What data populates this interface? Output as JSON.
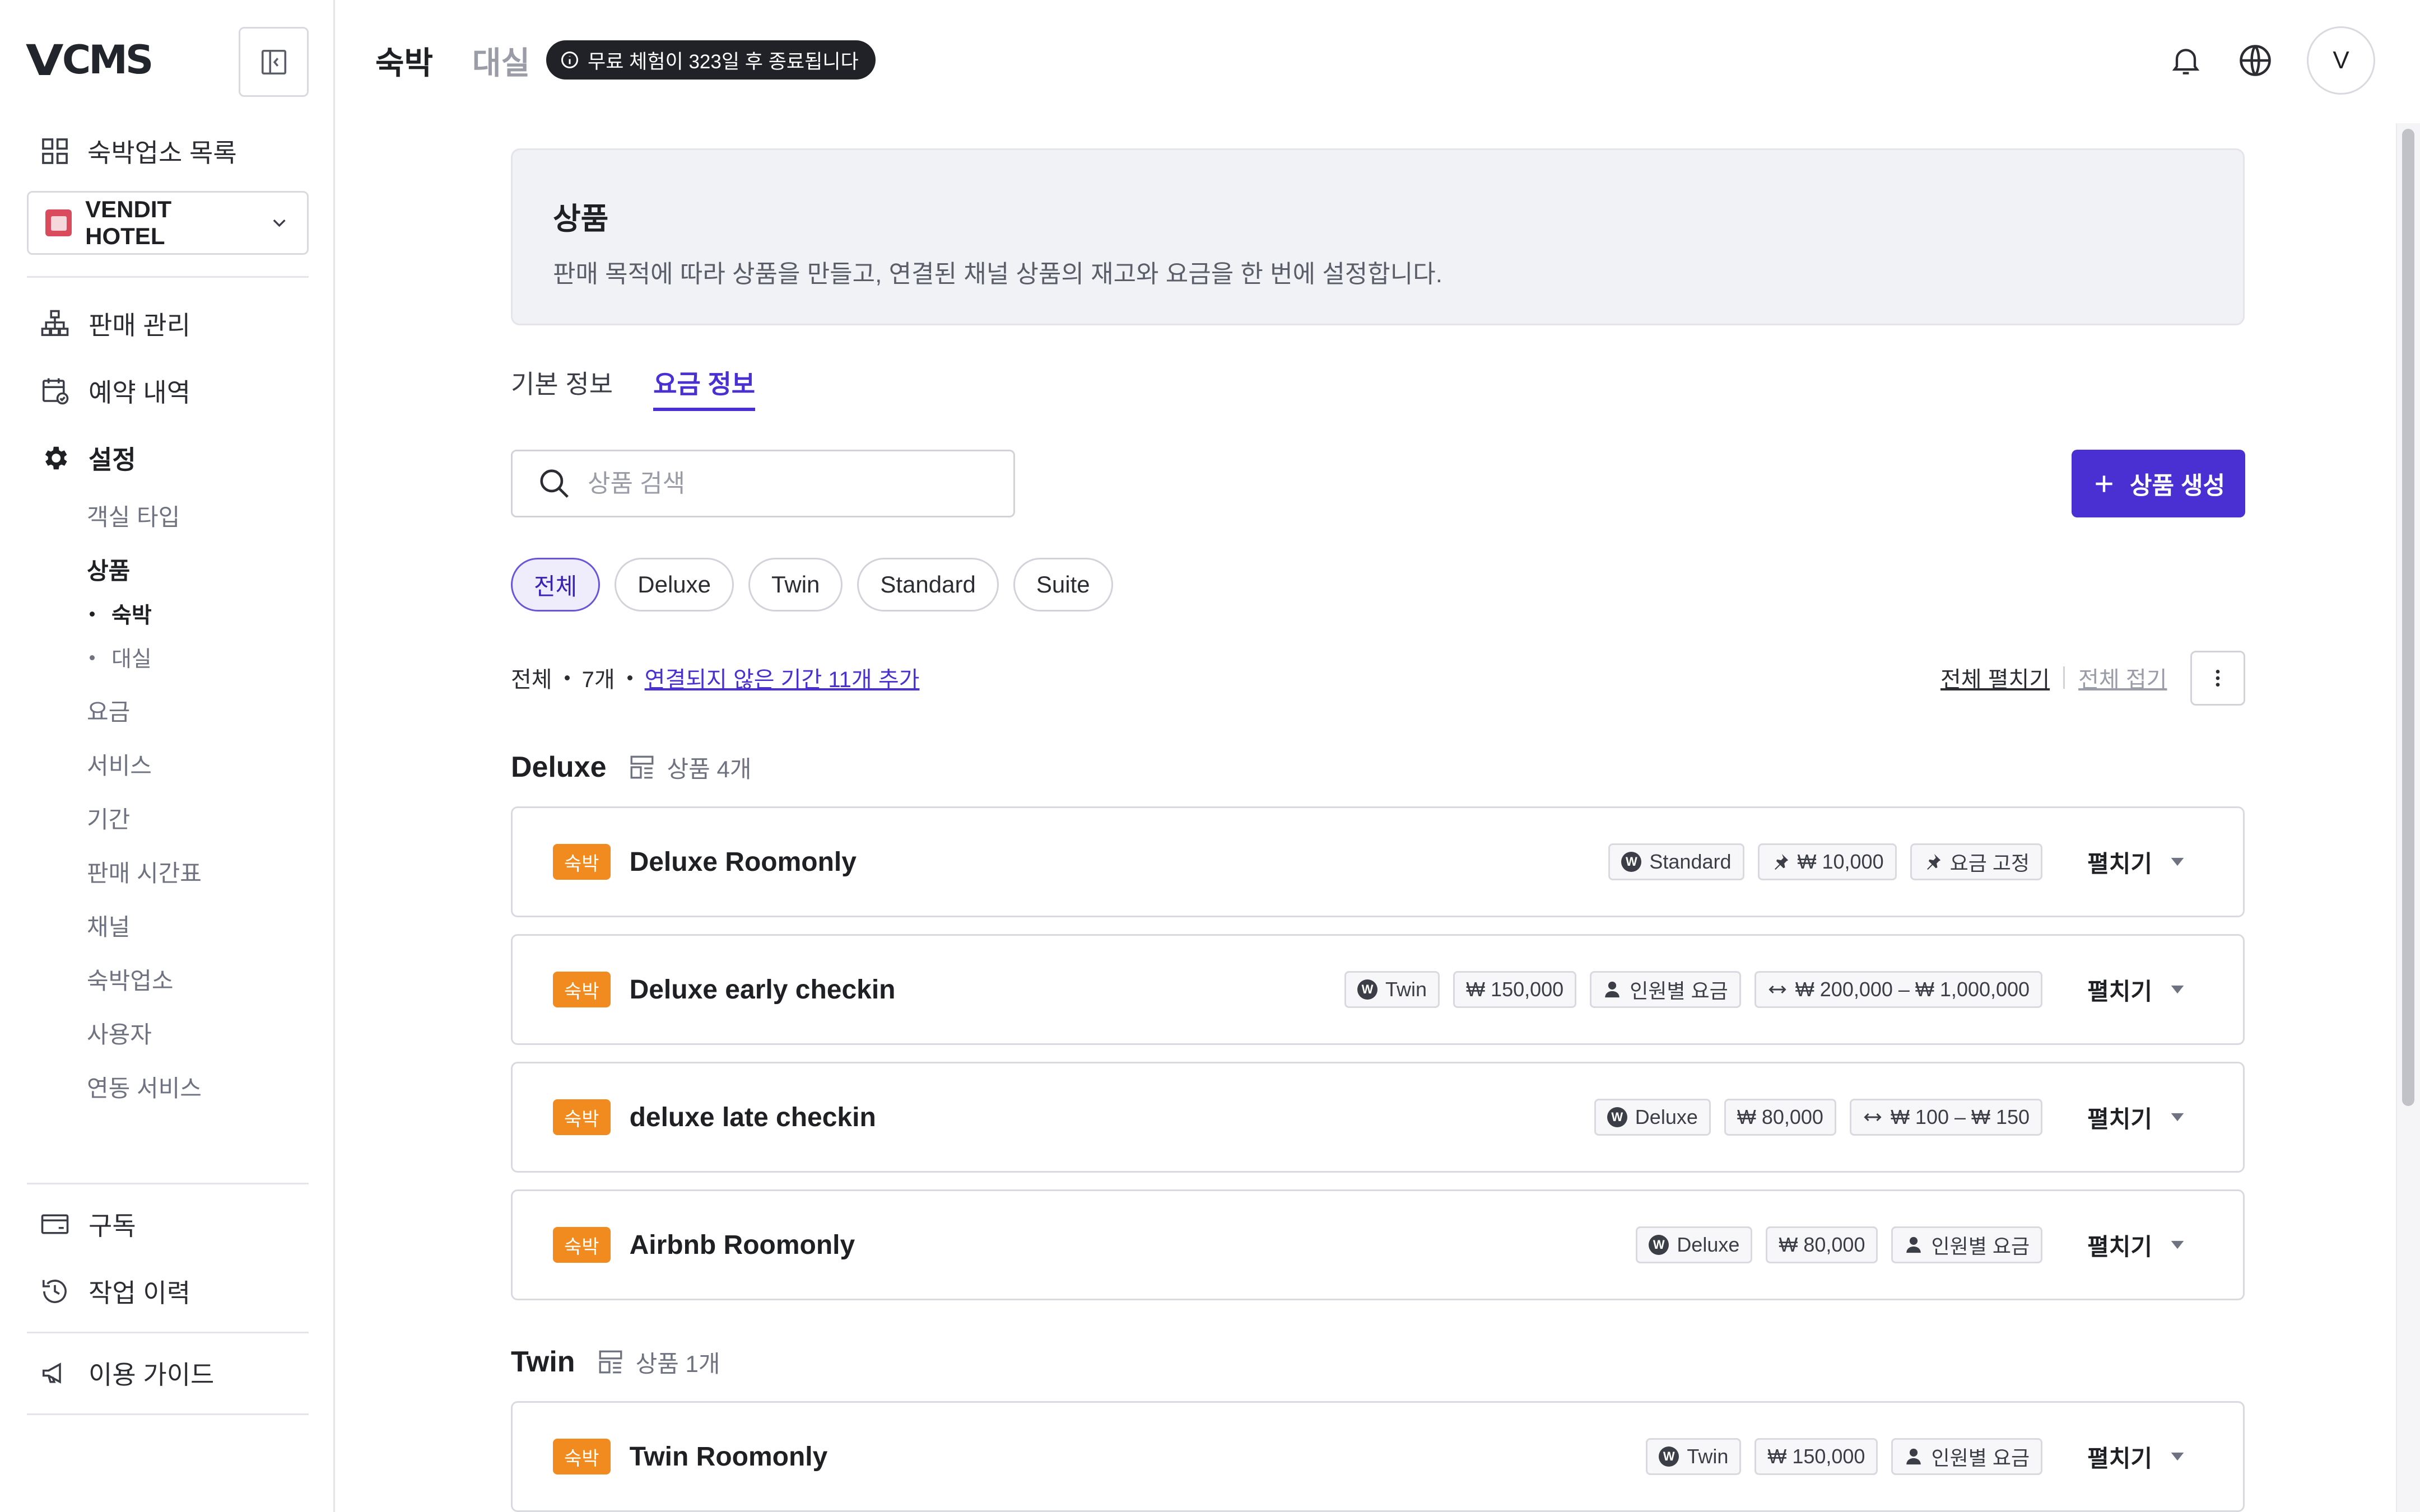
{
  "app": {
    "logo": "CMS"
  },
  "sidebar": {
    "top_link": "숙박업소 목록",
    "hotel": "VENDIT HOTEL",
    "nav": [
      {
        "label": "판매 관리",
        "icon": "sitemap-icon"
      },
      {
        "label": "예약 내역",
        "icon": "calendar-check-icon"
      },
      {
        "label": "설정",
        "icon": "gear-icon"
      }
    ],
    "settings_items": [
      "객실 타입",
      "상품",
      "요금",
      "서비스",
      "기간",
      "판매 시간표",
      "채널",
      "숙박업소",
      "사용자",
      "연동 서비스"
    ],
    "product_sub": [
      "숙박",
      "대실"
    ],
    "bottom": [
      {
        "label": "구독",
        "icon": "card-icon"
      },
      {
        "label": "작업 이력",
        "icon": "history-icon"
      },
      {
        "label": "이용 가이드",
        "icon": "megaphone-icon"
      }
    ]
  },
  "header": {
    "tab_active": "숙박",
    "tab_inactive": "대실",
    "trial": "무료 체험이 323일 후 종료됩니다",
    "avatar": "V"
  },
  "intro": {
    "title": "상품",
    "desc": "판매 목적에 따라 상품을 만들고, 연결된 채널 상품의 재고와 요금을 한 번에 설정합니다."
  },
  "tabs": [
    "기본 정보",
    "요금 정보"
  ],
  "search": {
    "placeholder": "상품 검색",
    "value": ""
  },
  "create_button": "상품 생성",
  "filters": [
    "전체",
    "Deluxe",
    "Twin",
    "Standard",
    "Suite"
  ],
  "summary": {
    "all": "전체",
    "count": "7개",
    "link": "연결되지 않은 기간 11개 추가",
    "expand_all": "전체 펼치기",
    "collapse_all": "전체 접기"
  },
  "groups": [
    {
      "name": "Deluxe",
      "count": "상품 4개"
    },
    {
      "name": "Twin",
      "count": "상품 1개"
    }
  ],
  "expand_label": "펼치기",
  "products": [
    {
      "badge": "숙박",
      "name": "Deluxe Roomonly",
      "tags": [
        {
          "icon": "w",
          "text": "Standard"
        },
        {
          "icon": "pin",
          "text": "₩ 10,000"
        },
        {
          "icon": "pin",
          "text": "요금 고정"
        }
      ]
    },
    {
      "badge": "숙박",
      "name": "Deluxe early checkin",
      "tags": [
        {
          "icon": "w",
          "text": "Twin"
        },
        {
          "icon": "",
          "text": "₩ 150,000"
        },
        {
          "icon": "person",
          "text": "인원별 요금"
        },
        {
          "icon": "range",
          "text": "₩ 200,000 – ₩ 1,000,000"
        }
      ]
    },
    {
      "badge": "숙박",
      "name": "deluxe late checkin",
      "tags": [
        {
          "icon": "w",
          "text": "Deluxe"
        },
        {
          "icon": "",
          "text": "₩ 80,000"
        },
        {
          "icon": "range",
          "text": "₩ 100 – ₩ 150"
        }
      ]
    },
    {
      "badge": "숙박",
      "name": "Airbnb Roomonly",
      "tags": [
        {
          "icon": "w",
          "text": "Deluxe"
        },
        {
          "icon": "",
          "text": "₩ 80,000"
        },
        {
          "icon": "person",
          "text": "인원별 요금"
        }
      ]
    },
    {
      "badge": "숙박",
      "name": "Twin Roomonly",
      "tags": [
        {
          "icon": "w",
          "text": "Twin"
        },
        {
          "icon": "",
          "text": "₩ 150,000"
        },
        {
          "icon": "person",
          "text": "인원별 요금"
        }
      ]
    }
  ],
  "colors": {
    "accent": "#4a2fd3",
    "badge": "#f18a1f"
  }
}
